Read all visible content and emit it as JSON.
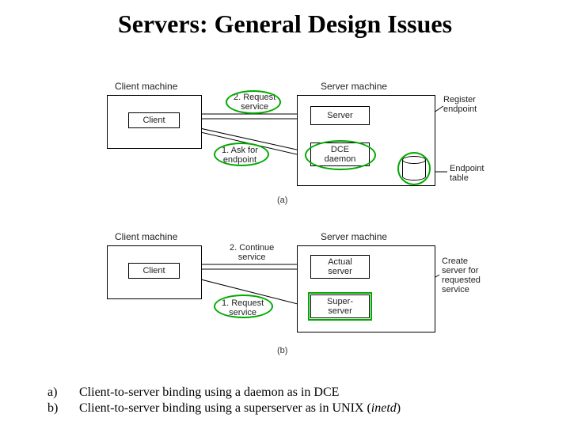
{
  "title": "Servers: General Design Issues",
  "diagram_a": {
    "client_machine_label": "Client machine",
    "server_machine_label": "Server machine",
    "client_box": "Client",
    "server_box": "Server",
    "dce_daemon_box": "DCE\ndaemon",
    "step2_label": "2. Request\nservice",
    "step1_label": "1. Ask for\nendpoint",
    "register_label": "Register\nendpoint",
    "endpoint_table_label": "Endpoint\ntable",
    "fig_label": "(a)"
  },
  "diagram_b": {
    "client_machine_label": "Client machine",
    "server_machine_label": "Server machine",
    "client_box": "Client",
    "actual_server_box": "Actual\nserver",
    "super_server_box": "Super-\nserver",
    "step2_label": "2. Continue\nservice",
    "step1_label": "1. Request\nservice",
    "create_label": "Create\nserver for\nrequested\nservice",
    "fig_label": "(b)"
  },
  "captions": {
    "a_letter": "a)",
    "a_text": "Client-to-server binding using a daemon as in DCE",
    "b_letter": "b)",
    "b_text_1": "Client-to-server binding using a superserver as in UNIX (",
    "b_text_italic": "inetd",
    "b_text_2": ")"
  }
}
